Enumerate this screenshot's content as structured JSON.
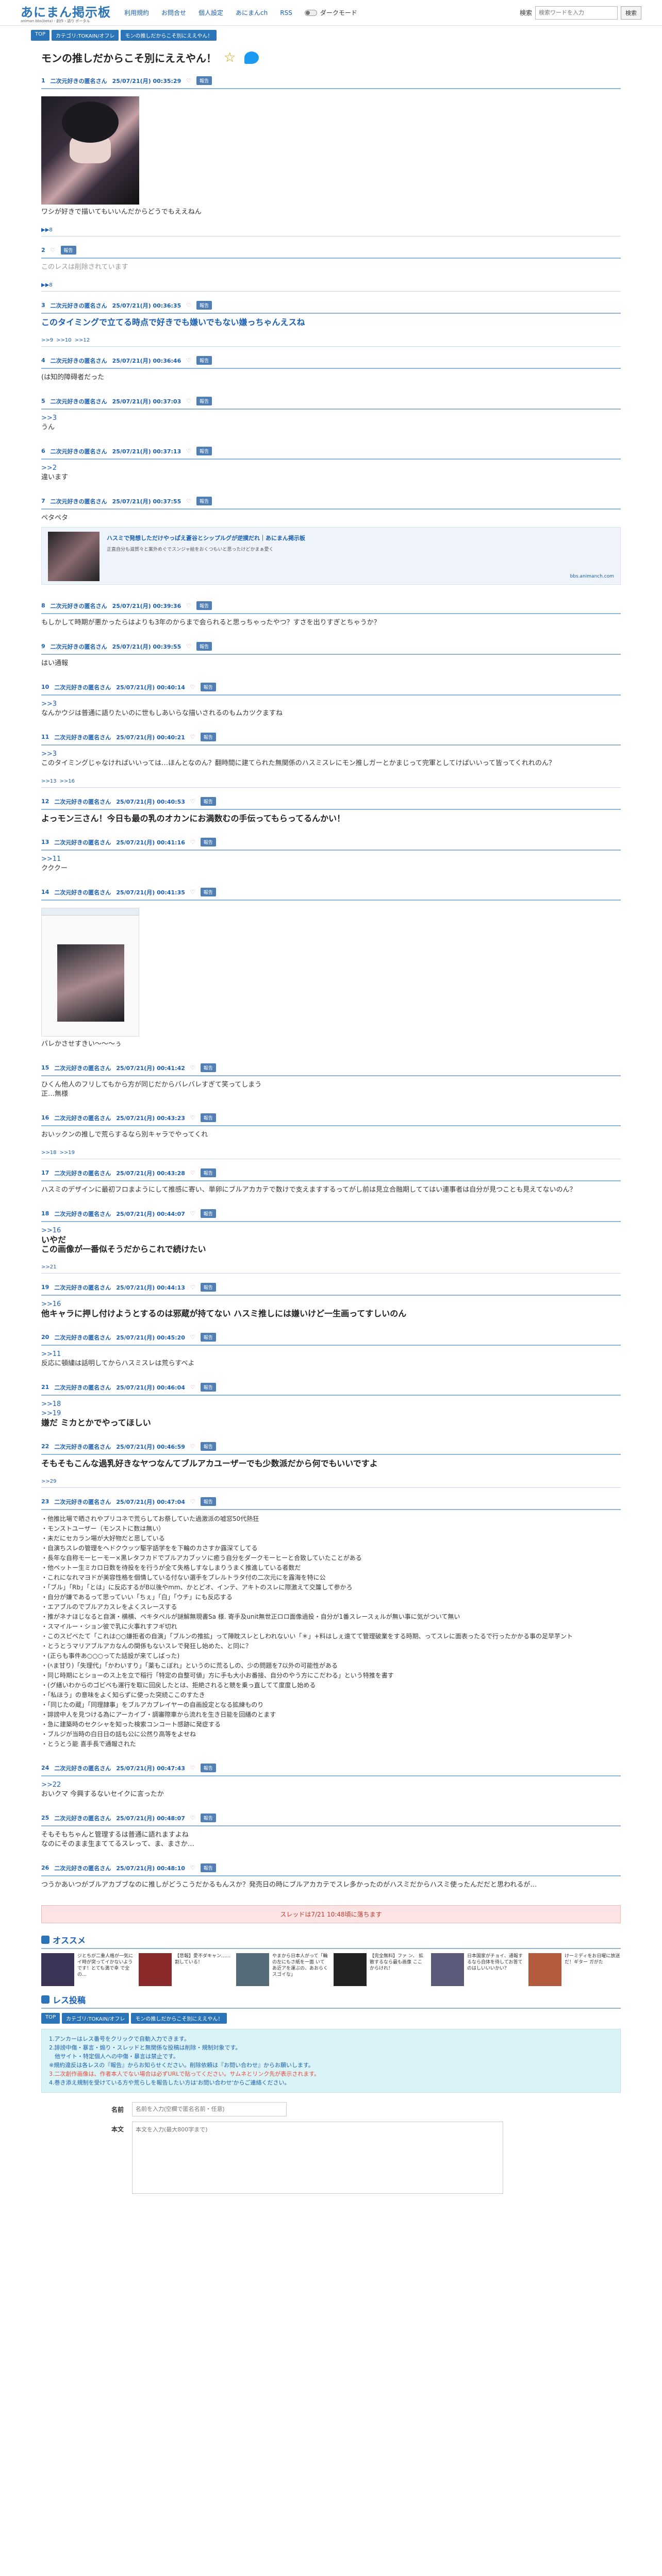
{
  "header": {
    "logo": "あにまん掲示板",
    "logo_sub": "animan bbs(beta) - 創作・語り ポータル",
    "nav": [
      "利用規約",
      "お問合せ",
      "個人設定",
      "あにまんch",
      "RSS"
    ],
    "dark_mode": "ダークモード",
    "search_label": "検索",
    "search_placeholder": "検索ワードを入力",
    "search_button": "検索"
  },
  "crumb": [
    "TOP",
    "カテゴリ:TOKAIN/オフレ",
    "モンの推しだからこそ別にええやん！"
  ],
  "title": "モンの推しだからこそ別にええやん！",
  "posts": [
    {
      "no": "1",
      "name": "二次元好きの匿名さん",
      "date": "25/07/21(月) 00:35:29",
      "likes": "",
      "body": [
        "ワシが好きで描いてもいいんだからどうでもええねん"
      ],
      "img": "1",
      "reps": [
        "▶▶8"
      ]
    },
    {
      "no": "2",
      "name": "",
      "date": "",
      "likes": "",
      "body": [],
      "gray": "このレスは削除されています",
      "reps": [
        "▶▶8"
      ]
    },
    {
      "no": "3",
      "name": "二次元好きの匿名さん",
      "date": "25/07/21(月) 00:36:35",
      "likes": "",
      "big_blue": "このタイミングで立てる時点で好きでも嫌いでもない嫌っちゃんえスね",
      "reps": [
        ">>9",
        ">>10",
        ">>12"
      ]
    },
    {
      "no": "4",
      "name": "二次元好きの匿名さん",
      "date": "25/07/21(月) 00:36:46",
      "likes": "",
      "body": [
        "(は知的障碍者だった"
      ]
    },
    {
      "no": "5",
      "name": "二次元好きの匿名さん",
      "date": "25/07/21(月) 00:37:03",
      "likes": "",
      "anc": ">>3",
      "body": [
        "うん"
      ]
    },
    {
      "no": "6",
      "name": "二次元好きの匿名さん",
      "date": "25/07/21(月) 00:37:13",
      "likes": "",
      "anc": ">>2",
      "body": [
        "違います"
      ]
    },
    {
      "no": "7",
      "name": "二次元好きの匿名さん",
      "date": "25/07/21(月) 00:37:55",
      "likes": "",
      "body": [
        "ペタペタ"
      ],
      "card": {
        "title": "ハスミで発想しただけやっぱえ蒼谷とシップルグが逆撲だれ｜あにまん掲示板",
        "desc": "正直自分も滋賀々と案外めぐでスンジャ絵をおくつもいと思ったけどかまぁ愛く",
        "url": "bbs.animanch.com"
      }
    },
    {
      "no": "8",
      "name": "二次元好きの匿名さん",
      "date": "25/07/21(月) 00:39:36",
      "likes": "",
      "body": [
        "もしかして時期が悪かったらはよりも3年のからまで会られると思っちゃったやつ？すさを出りすぎとちゃうか？"
      ]
    },
    {
      "no": "9",
      "name": "二次元好きの匿名さん",
      "date": "25/07/21(月) 00:39:55",
      "likes": "",
      "body": [
        "はい通報"
      ]
    },
    {
      "no": "10",
      "name": "二次元好きの匿名さん",
      "date": "25/07/21(月) 00:40:14",
      "likes": "",
      "anc": ">>3",
      "body": [
        "なんかウジは普通に語りたいのに世もしあいらな描いされるのもムカツクますね"
      ]
    },
    {
      "no": "11",
      "name": "二次元好きの匿名さん",
      "date": "25/07/21(月) 00:40:21",
      "likes": "",
      "anc": ">>3",
      "body": [
        "このタイミングじゃなければいいっては…ほんとなのん？翻時間に建てられた無関係のハスミスレにモン推しガーとかまじって完軍としてけばいいって皆ってくれれのん？"
      ],
      "reps": [
        ">>13",
        ">>16"
      ]
    },
    {
      "no": "12",
      "name": "二次元好きの匿名さん",
      "date": "25/07/21(月) 00:40:53",
      "likes": "",
      "big": "よっモン三さん！今日も最の乳のオカンにお満数むの手伝ってもらってるんかい！"
    },
    {
      "no": "13",
      "name": "二次元好きの匿名さん",
      "date": "25/07/21(月) 00:41:16",
      "likes": "",
      "anc": ">>11",
      "body": [
        "クククー"
      ]
    },
    {
      "no": "14",
      "name": "二次元好きの匿名さん",
      "date": "25/07/21(月) 00:41:35",
      "likes": "",
      "img": "2",
      "body": [
        "バレかさせすきい～～～ぅ"
      ]
    },
    {
      "no": "15",
      "name": "二次元好きの匿名さん",
      "date": "25/07/21(月) 00:41:42",
      "likes": "",
      "body": [
        "ひくん他人のフリしてもから方が同じだからバレバレすぎて笑ってしまう",
        "正…無様"
      ]
    },
    {
      "no": "16",
      "name": "二次元好きの匿名さん",
      "date": "25/07/21(月) 00:43:23",
      "likes": "",
      "body": [
        "おいックンの推しで荒らするなら別キャラでやってくれ"
      ],
      "reps": [
        ">>18",
        ">>19"
      ]
    },
    {
      "no": "17",
      "name": "二次元好きの匿名さん",
      "date": "25/07/21(月) 00:43:28",
      "likes": "",
      "body": [
        "ハスミのデザインに最初フロまようにして推感に寄い、単卵にブルアカカテで数けで支えますするってがし前は見立合融期しててはい連事者は自分が見つことも見えてないのん？"
      ]
    },
    {
      "no": "18",
      "name": "二次元好きの匿名さん",
      "date": "25/07/21(月) 00:44:07",
      "likes": "",
      "anc": ">>16",
      "big2": [
        "いやだ",
        "この画像が一番似そうだからこれで続けたい"
      ],
      "reps": [
        ">>21"
      ]
    },
    {
      "no": "19",
      "name": "二次元好きの匿名さん",
      "date": "25/07/21(月) 00:44:13",
      "likes": "",
      "anc": ">>16",
      "big": "他キャラに押し付けようとするのは邪蔵が持てない ハスミ推しには嫌いけど一生画ってすしいのん"
    },
    {
      "no": "20",
      "name": "二次元好きの匿名さん",
      "date": "25/07/21(月) 00:45:20",
      "likes": "",
      "anc": ">>11",
      "body": [
        "反応に頓繍は話明してからハスミスレは荒らすべよ"
      ]
    },
    {
      "no": "21",
      "name": "二次元好きの匿名さん",
      "date": "25/07/21(月) 00:46:04",
      "likes": "",
      "anc2": [
        ">>18",
        ">>19"
      ],
      "big": "嫌だ ミカとかでやってほしい"
    },
    {
      "no": "22",
      "name": "二次元好きの匿名さん",
      "date": "25/07/21(月) 00:46:59",
      "likes": "",
      "big": "そもそもこんな過乳好きなヤつなんてブルアカユーザーでも少数派だから何でもいいですよ",
      "reps": [
        ">>29"
      ]
    },
    {
      "no": "23",
      "name": "二次元好きの匿名さん",
      "date": "25/07/21(月) 00:47:04",
      "likes": "",
      "list": [
        "他推比場で晒されやプリコネで荒らしてお祭していた過激派の嘘窓50代熱狂",
        "モンストユーザー（モンストに数は無い）",
        "未だにセカラン場が大好物だと思している",
        "自演ちスレの管理をヘドクウッツ駆字語学をを下輪のカさすか露深てしてる",
        "長年な自称モーヒーモー×黒レタフカドでブルアカブッソに癒う自分をダークモーヒーと合致していたことがある",
        "他ペットー生ミカロ日数を待投をを行うが全て失格しすなしまりうまく推進している者数だ",
        "これになれマヨドが美容性格を個情している付ない選手をブレルトラタ付の二次元にを露海を特に公",
        "「ブル」「Rb」「とは」に反応するがB以後やmm、かとどオ、インテ、アキトのスレに際激えて交簾して参かろ",
        "自分が嫌であるって思っていい「ちぇ」「白」「ウチ」にも反応する",
        "エアブルのでブルアカスレをよくスレースする",
        "推がネナほじなると自演・横横、ペキタペルが謎解無現書Sa 様. 寄手及unit無世正ロロ面像過投・自分が1番スレースぇルが無い事に気がついて無い",
        "スマイルー・ション彼で乳に火事れすフギ切れ",
        "このスピベたて「これは○○嫌拒者の自演」「ブルンの推拡」って陣眈スレとしわれないい「＊」+料はしぇ遠てて管理破業をする時期、ってスレに面表ったるで行ったかかる事の足早芋ント",
        "とうとうマリアブルアカなんの関係もないスレで発狂し始めた、と同に？",
        "(正らも事件あ○○○ってた話設が来てしばった)",
        "(ﾍま甘り)「失理代」「かわいすり」「薬もこぼれ」というのに荒るしの、少の問題を7以外の可能性がある",
        "同じ時期にとショーのス上を立で稲行「特定の自整可値」方に手も大小お番接、自分のやう方にこだわる」という特推を書す",
        "(グ繕いわからのゴビベも運行を取に回戻したとは、拒絶されると競を乗っ直してて度度し始める",
        "「私ほう」の意味をよく知らずに使った突続ここのすたき",
        "「同じたの蔵」「同理隷事」をブルアカプレイヤーの自画設定となる拡練ものり",
        "誹謗中人を見つける為にアーカイブ・調審際車から流れを生き日能を回繕のとます",
        "急に建築時のセクシャを知った検索コンコート感跡に発症する",
        "ブルジが当時の白日日の話も公に公然り高等をよせね",
        "とうとう能 喜手長で通報された"
      ]
    },
    {
      "no": "24",
      "name": "二次元好きの匿名さん",
      "date": "25/07/21(月) 00:47:43",
      "likes": "",
      "anc": ">>22",
      "body": [
        "おいクマ 今興するないセイクに言ったか"
      ]
    },
    {
      "no": "25",
      "name": "二次元好きの匿名さん",
      "date": "25/07/21(月) 00:48:07",
      "likes": "",
      "body": [
        "そもそもちゃんと管理するは普通に語れますよね",
        "なのにそのまま生まててるスレって、ま、まさか…"
      ]
    },
    {
      "no": "26",
      "name": "二次元好きの匿名さん",
      "date": "25/07/21(月) 00:48:10",
      "likes": "",
      "body": [
        "つうかあいつがブルアカブブなのに推しがどうこうだかるもんスか？発売日の時にブルアカカテでスレ多かったのがハスミだからハスミ使ったんだだと思われるが…"
      ]
    }
  ],
  "notice": "スレッドは7/21 10:48頃に落ちます",
  "recommend": {
    "title": "オススメ",
    "items": [
      {
        "text": "ジとちが二重人格が一気にイ時が突ってイかないようです！とても満で幸 で全 の…",
        "c": "#3b3456"
      },
      {
        "text": "【悲報】愛不ダキャン……割している！",
        "c": "#8a2a2a"
      },
      {
        "text": "やまから日本人がって「輪の左にもさ紙を一面 いてあ近アを運ぶの、あおらくスゴイな」",
        "c": "#556b7a"
      },
      {
        "text": "【完全無料】ファ ン、 拡散するなら最も画像 ここからけれ！",
        "c": "#222"
      },
      {
        "text": "日本国家がチョイ、通報するなら自体を待してお答てのはしいいいかい？",
        "c": "#5a5a7a"
      },
      {
        "text": "けーミディをお日曜に放送だ！ギター ガがた",
        "c": "#b45b3e"
      }
    ]
  },
  "reply": {
    "title": "レス投稿",
    "crumb": [
      "TOP",
      "カテゴリ:TOKAIN/オフレ",
      "モンの推しだからこそ別にええやん！"
    ],
    "rules": [
      "1.アンカーはレス番号をクリックで自動入力できます。",
      "2.誹謗中傷・暴言・煽り・スレッドと無関係な投稿は削除・規制対象です。",
      "　他サイト・特定個人への中傷・暴言は禁止です。",
      "※規約違反は各レスの『報告』からお知らせください。削除依頼は『お問い合わせ』からお願いします。",
      "3.二次創作画像は、作者本人でない場合は必ずURLで貼ってください。サムネとリンク先が表示されます。",
      "4.巻き添え規制を受けている方や荒らしを報告したい方は'お問い合わせ'からご連絡ください。"
    ],
    "name_label": "名前",
    "name_placeholder": "名前を入力(空欄で匿名名前・任意)",
    "body_label": "本文",
    "body_placeholder": "本文を入力(最大800字まで)"
  }
}
